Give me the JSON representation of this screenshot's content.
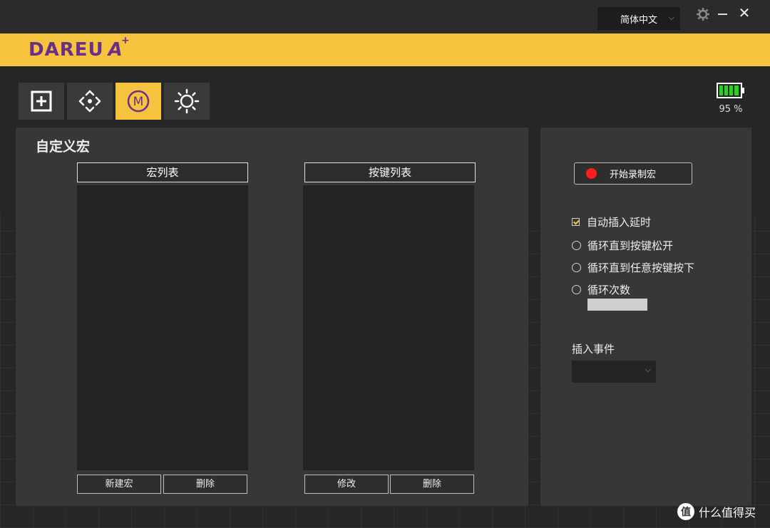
{
  "titlebar": {
    "language": "简体中文"
  },
  "brand": {
    "name": "DAREU",
    "mark": "A"
  },
  "toolbar": {
    "tools": [
      "plus-square-icon",
      "move-arrows-icon",
      "macro-m-icon",
      "brightness-icon"
    ],
    "active_index": 2
  },
  "battery": {
    "percent_label": "95 %",
    "level": 0.95
  },
  "main": {
    "title": "自定义宏",
    "macro_list": {
      "header": "宏列表",
      "items": [],
      "new_label": "新建宏",
      "delete_label": "删除"
    },
    "key_list": {
      "header": "按键列表",
      "items": [],
      "edit_label": "修改",
      "delete_label": "删除"
    }
  },
  "side": {
    "record_label": "开始录制宏",
    "auto_delay_label": "自动插入延时",
    "auto_delay_checked": true,
    "loop_options": [
      "循环直到按键松开",
      "循环直到任意按键按下",
      "循环次数"
    ],
    "loop_count_value": "",
    "insert_event_label": "插入事件",
    "insert_event_value": ""
  },
  "watermark": {
    "text": "什么值得买",
    "badge": "值"
  },
  "colors": {
    "accent": "#f6c33f",
    "brand_text": "#6a2f86",
    "record": "#ff1e1e",
    "battery": "#2bd31a"
  }
}
